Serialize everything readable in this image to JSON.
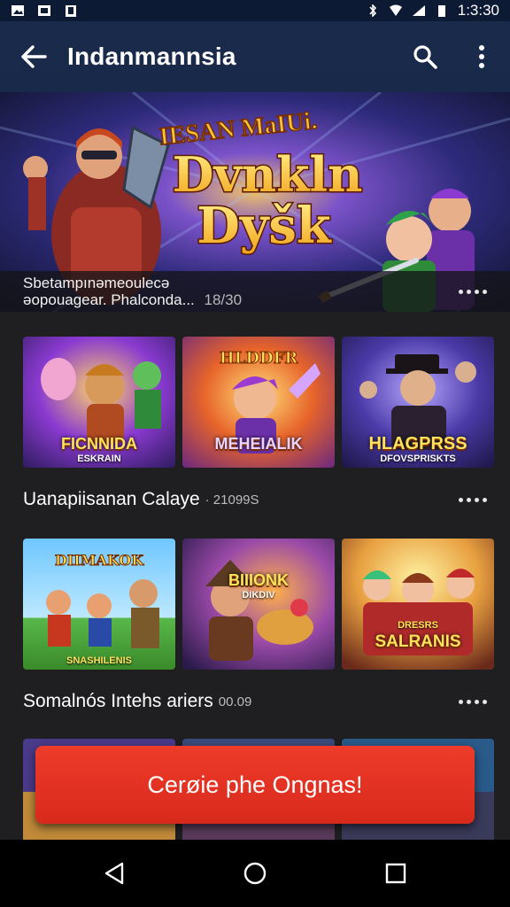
{
  "status_bar": {
    "time": "1:3:30",
    "icons": [
      "image-icon",
      "photo-icon",
      "clipboard-icon",
      "bluetooth-icon",
      "wifi-icon",
      "signal-icon",
      "battery-icon"
    ]
  },
  "app_bar": {
    "title": "Indanmannsia",
    "back_icon": "arrow-left-icon",
    "search_icon": "search-icon",
    "menu_icon": "more-vertical-icon"
  },
  "hero": {
    "top_banner": "IESAN MaIUi.",
    "title_line1": "Dvnkln",
    "title_line2": "Dyšk",
    "caption_line1": "Sbetampınəmeoulecə",
    "caption_line2": "əopouagear. Phalconda...",
    "caption_count": "18/30",
    "more_icon": "more-horizontal-icon"
  },
  "row1": {
    "tiles": [
      {
        "label": "FICNNIDA",
        "sub": "ESKRAIN"
      },
      {
        "label": "HLDDFR",
        "sub": "MEHEIALIK"
      },
      {
        "label": "HLAGPRSS",
        "sub": "DFOVSPRISKTS"
      }
    ]
  },
  "section1": {
    "title": "Uanapiisanan Calaye",
    "count": "· 21099S"
  },
  "row2": {
    "tiles": [
      {
        "label": "DIIMAKOK",
        "sub": "SNASHILENIS"
      },
      {
        "label": "BIIIONK",
        "sub": "DIKDIV"
      },
      {
        "label": "DRESRS",
        "sub": "SALRANIS"
      }
    ]
  },
  "section2": {
    "title": "Somalnós Intehs ariers",
    "count": "00.09"
  },
  "cta": {
    "label": "Cerøie phe Ongnas!"
  },
  "nav": {
    "back_icon": "triangle-back-icon",
    "home_icon": "circle-home-icon",
    "recents_icon": "square-recents-icon"
  },
  "colors": {
    "app_bar": "#1a2a4a",
    "background": "#1f1f21",
    "cta": "#e3321f",
    "title_gold": "#ffd23a"
  }
}
